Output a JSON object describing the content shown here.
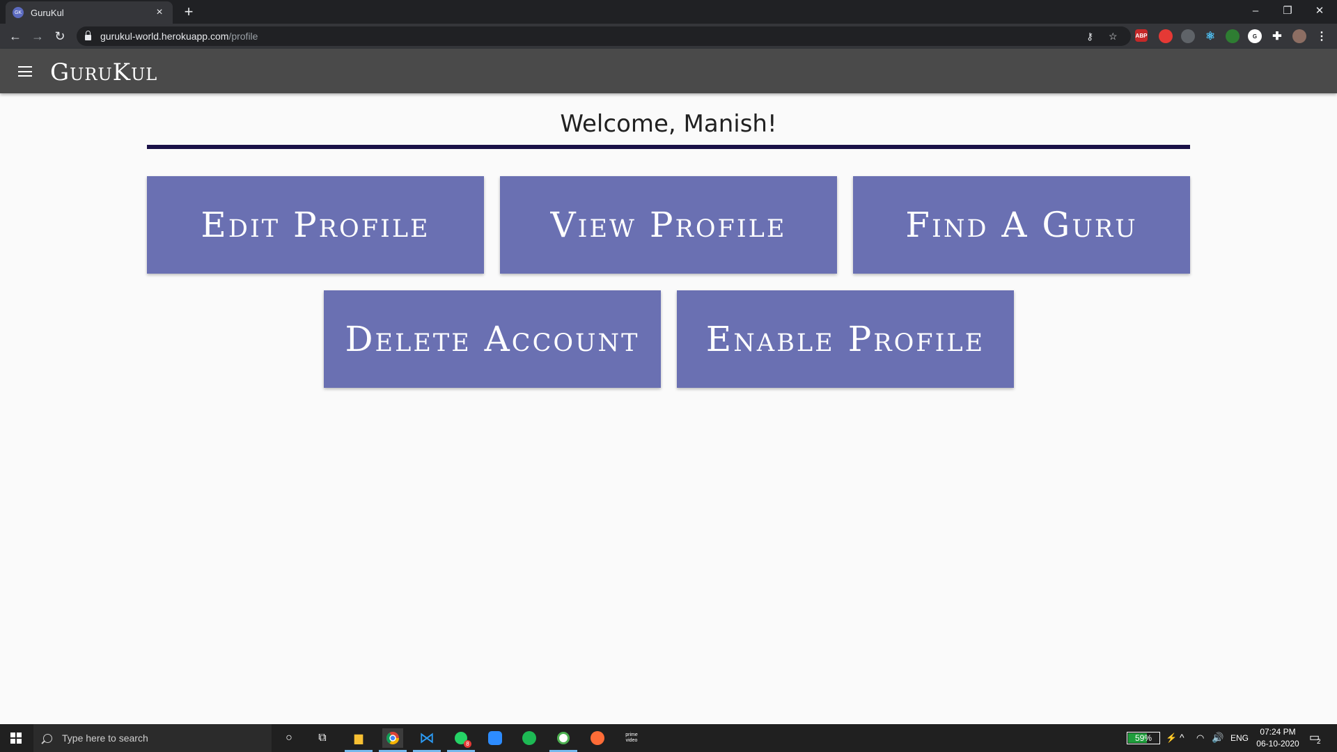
{
  "browser": {
    "tab_title": "GuruKul",
    "tab_favicon_text": "GK",
    "url_host": "gurukul-world.herokuapp.com",
    "url_path": "/profile"
  },
  "app": {
    "brand": "GuruKul",
    "welcome": "Welcome, Manish!",
    "accent_color": "#1a1147",
    "button_color": "#6a70b2",
    "appbar_color": "#4a4a4a",
    "actions": [
      {
        "label": "Edit Profile"
      },
      {
        "label": "View Profile"
      },
      {
        "label": "Find A Guru"
      },
      {
        "label": "Delete Account"
      },
      {
        "label": "Enable Profile"
      }
    ]
  },
  "extensions": {
    "abp_label": "ABP"
  },
  "taskbar": {
    "search_placeholder": "Type here to search",
    "prime_label": "prime video",
    "battery_percent": "59%",
    "battery_level": 0.59,
    "language": "ENG",
    "time": "07:24 PM",
    "date": "06-10-2020",
    "notification_count": "2",
    "badge_count": "8"
  }
}
